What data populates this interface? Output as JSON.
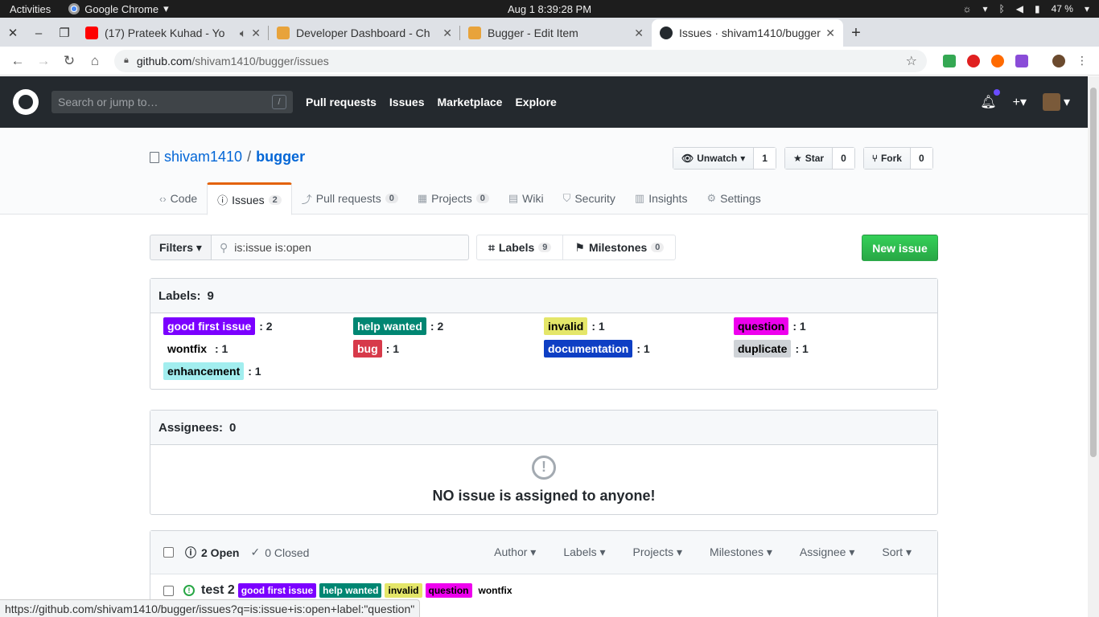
{
  "os": {
    "activities": "Activities",
    "app": "Google Chrome",
    "clock": "Aug 1   8:39:28 PM",
    "battery": "47 %"
  },
  "tabs": [
    {
      "title": "(17) Prateek Kuhad - Yo",
      "color": "#ff0000"
    },
    {
      "title": "Developer Dashboard - Ch",
      "color": "#e8a33b"
    },
    {
      "title": "Bugger - Edit Item",
      "color": "#e8a33b"
    },
    {
      "title": "Issues · shivam1410/bugger",
      "color": "#24292e"
    }
  ],
  "address": {
    "host": "github.com",
    "path": "/shivam1410/bugger/issues"
  },
  "gh": {
    "search_placeholder": "Search or jump to…",
    "slash": "/",
    "nav": [
      "Pull requests",
      "Issues",
      "Marketplace",
      "Explore"
    ]
  },
  "repo": {
    "owner": "shivam1410",
    "sep": "/",
    "name": "bugger",
    "unwatch": "Unwatch",
    "unwatch_count": "1",
    "star": "Star",
    "star_count": "0",
    "fork": "Fork",
    "fork_count": "0",
    "tabs": [
      {
        "label": "Code",
        "count": ""
      },
      {
        "label": "Issues",
        "count": "2"
      },
      {
        "label": "Pull requests",
        "count": "0"
      },
      {
        "label": "Projects",
        "count": "0"
      },
      {
        "label": "Wiki",
        "count": ""
      },
      {
        "label": "Security",
        "count": ""
      },
      {
        "label": "Insights",
        "count": ""
      },
      {
        "label": "Settings",
        "count": ""
      }
    ]
  },
  "filters": {
    "button": "Filters",
    "query": "is:issue is:open",
    "labels": "Labels",
    "labels_count": "9",
    "milestones": "Milestones",
    "milestones_count": "0",
    "new_issue": "New issue"
  },
  "labels_box": {
    "title": "Labels:",
    "count": "9",
    "items": [
      {
        "name": "good first issue",
        "count": ": 2",
        "bg": "#7b00ff",
        "fg": "#ffffff"
      },
      {
        "name": "help wanted",
        "count": ": 2",
        "bg": "#008672",
        "fg": "#ffffff"
      },
      {
        "name": "invalid",
        "count": ": 1",
        "bg": "#e4e669",
        "fg": "#000000"
      },
      {
        "name": "question",
        "count": ": 1",
        "bg": "#ee00ee",
        "fg": "#000000"
      },
      {
        "name": "wontfix",
        "count": ": 1",
        "bg": "#ffffff",
        "fg": "#000000"
      },
      {
        "name": "bug",
        "count": ": 1",
        "bg": "#d73a4a",
        "fg": "#ffffff"
      },
      {
        "name": "documentation",
        "count": ": 1",
        "bg": "#0e3fc4",
        "fg": "#ffffff"
      },
      {
        "name": "duplicate",
        "count": ": 1",
        "bg": "#cfd3d7",
        "fg": "#000000"
      },
      {
        "name": "enhancement",
        "count": ": 1",
        "bg": "#a2eeef",
        "fg": "#000000"
      }
    ]
  },
  "assignees_box": {
    "title": "Assignees:",
    "count": "0",
    "message": "NO issue is assigned to anyone!"
  },
  "issues": {
    "open": "2 Open",
    "closed": "0 Closed",
    "menus": [
      "Author",
      "Labels",
      "Projects",
      "Milestones",
      "Assignee",
      "Sort"
    ],
    "rows": [
      {
        "title": "test 2",
        "tags": [
          {
            "name": "good first issue",
            "bg": "#7b00ff",
            "fg": "#ffffff"
          },
          {
            "name": "help wanted",
            "bg": "#008672",
            "fg": "#ffffff"
          },
          {
            "name": "invalid",
            "bg": "#e4e669",
            "fg": "#000000"
          },
          {
            "name": "question",
            "bg": "#ee00ee",
            "fg": "#000000"
          },
          {
            "name": "wontfix",
            "bg": "#ffffff",
            "fg": "#000000"
          }
        ]
      }
    ]
  },
  "status_url": "https://github.com/shivam1410/bugger/issues?q=is:issue+is:open+label:\"question\""
}
